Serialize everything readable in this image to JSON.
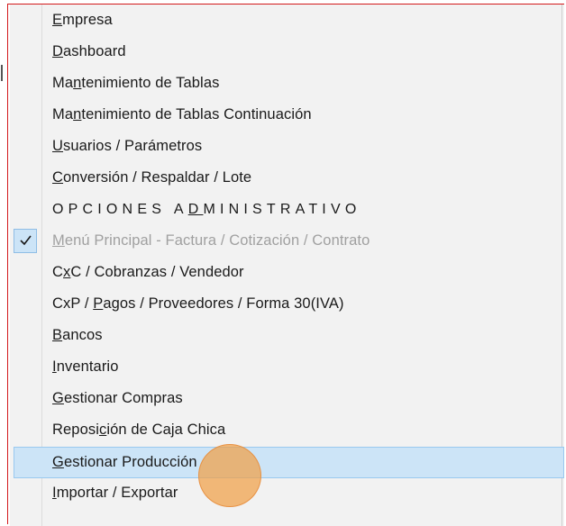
{
  "menu": {
    "items": [
      {
        "label": "Empresa",
        "ul": 0,
        "state": "normal"
      },
      {
        "label": "Dashboard",
        "ul": 0,
        "state": "normal"
      },
      {
        "label": "Mantenimiento de Tablas",
        "ul": 2,
        "state": "normal"
      },
      {
        "label": "Mantenimiento de Tablas Continuación",
        "ul": 2,
        "state": "normal"
      },
      {
        "label": "Usuarios / Parámetros",
        "ul": 0,
        "state": "normal"
      },
      {
        "label": "Conversión / Respaldar / Lote",
        "ul": 0,
        "state": "normal"
      },
      {
        "label": "OPCIONES ADMINISTRATIVO",
        "ul": 10,
        "state": "header"
      },
      {
        "label": "Menú Principal - Factura / Cotización / Contrato",
        "ul": 0,
        "state": "disabled",
        "checked": true
      },
      {
        "label": "CxC / Cobranzas / Vendedor",
        "ul": 1,
        "state": "normal"
      },
      {
        "label": "CxP / Pagos / Proveedores / Forma 30(IVA)",
        "ul": 6,
        "state": "normal"
      },
      {
        "label": "Bancos",
        "ul": 0,
        "state": "normal"
      },
      {
        "label": "Inventario",
        "ul": 0,
        "state": "normal"
      },
      {
        "label": "Gestionar Compras",
        "ul": 0,
        "state": "normal"
      },
      {
        "label": "Reposición de Caja Chica",
        "ul": 6,
        "state": "normal"
      },
      {
        "label": "Gestionar Producción",
        "ul": 0,
        "state": "selected"
      },
      {
        "label": "Importar / Exportar",
        "ul": 0,
        "state": "normal"
      }
    ]
  }
}
